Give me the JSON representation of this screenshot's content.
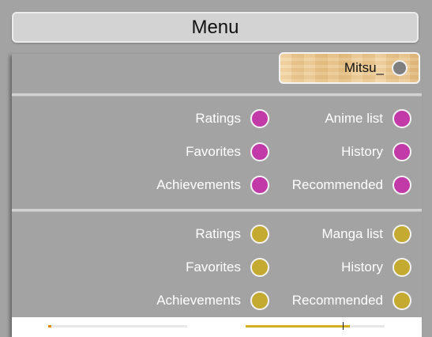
{
  "header": {
    "title": "Menu"
  },
  "user": {
    "name": "Mitsu_"
  },
  "colors": {
    "anime_accent": "#c13aa8",
    "manga_accent": "#c4aa31",
    "progress_anime": "#e08a00",
    "progress_manga": "#d0b020"
  },
  "anime_menu": {
    "left": [
      {
        "label": "Ratings"
      },
      {
        "label": "Favorites"
      },
      {
        "label": "Achievements"
      }
    ],
    "right": [
      {
        "label": "Anime list"
      },
      {
        "label": "History"
      },
      {
        "label": "Recommended"
      }
    ]
  },
  "manga_menu": {
    "left": [
      {
        "label": "Ratings"
      },
      {
        "label": "Favorites"
      },
      {
        "label": "Achievements"
      }
    ],
    "right": [
      {
        "label": "Manga list"
      },
      {
        "label": "History"
      },
      {
        "label": "Recommended"
      }
    ]
  },
  "footer": {
    "anime_progress": 0.01,
    "manga_progress": 0.75,
    "manga_marker": 0.7
  }
}
